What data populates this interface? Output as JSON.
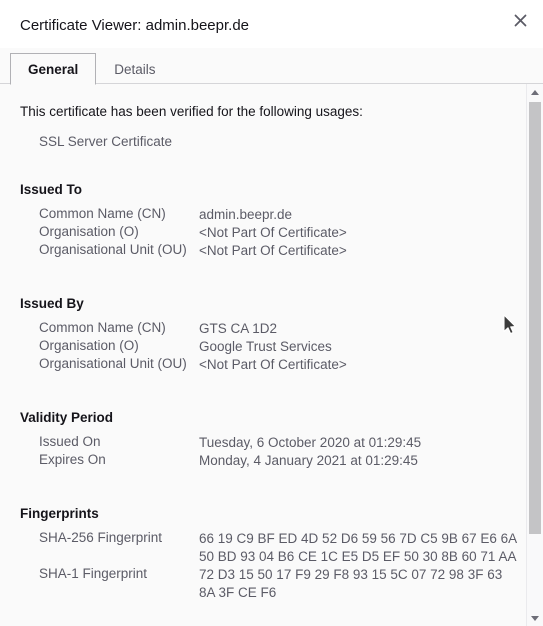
{
  "window": {
    "title": "Certificate Viewer: admin.beepr.de",
    "close_icon": "close-icon"
  },
  "tabs": [
    {
      "label": "General",
      "active": true
    },
    {
      "label": "Details",
      "active": false
    }
  ],
  "general": {
    "verified_text": "This certificate has been verified for the following usages:",
    "usages": [
      "SSL Server Certificate"
    ],
    "sections": [
      {
        "id": "issued-to",
        "title": "Issued To",
        "rows": [
          {
            "label": "Common Name (CN)",
            "value": "admin.beepr.de"
          },
          {
            "label": "Organisation (O)",
            "value": "<Not Part Of Certificate>"
          },
          {
            "label": "Organisational Unit (OU)",
            "value": "<Not Part Of Certificate>"
          }
        ]
      },
      {
        "id": "issued-by",
        "title": "Issued By",
        "rows": [
          {
            "label": "Common Name (CN)",
            "value": "GTS CA 1D2"
          },
          {
            "label": "Organisation (O)",
            "value": "Google Trust Services"
          },
          {
            "label": "Organisational Unit (OU)",
            "value": "<Not Part Of Certificate>"
          }
        ]
      },
      {
        "id": "validity-period",
        "title": "Validity Period",
        "rows": [
          {
            "label": "Issued On",
            "value": "Tuesday, 6 October 2020 at 01:29:45"
          },
          {
            "label": "Expires On",
            "value": "Monday, 4 January 2021 at 01:29:45"
          }
        ]
      },
      {
        "id": "fingerprints",
        "title": "Fingerprints",
        "rows": [
          {
            "label": "SHA-256 Fingerprint",
            "value": "66 19 C9 BF ED 4D 52 D6 59 56 7D C5 9B 67 E6 6A\n50 BD 93 04 B6 CE 1C E5 D5 EF 50 30 8B 60 71 AA"
          },
          {
            "label": "SHA-1 Fingerprint",
            "value": "72 D3 15 50 17 F9 29 F8 93 15 5C 07 72 98 3F 63\n8A 3F CE F6"
          }
        ]
      }
    ]
  },
  "scrollbar": {
    "up_arrow_icon": "triangle-up-icon",
    "down_arrow_icon": "triangle-down-icon"
  },
  "colors": {
    "text_primary": "#15141a",
    "text_secondary": "#5b5b66",
    "titlebar_bg": "#ffffff",
    "content_bg": "#fafafa",
    "border": "#d5d5d8",
    "scrollbar_thumb": "#c4c4c6"
  }
}
